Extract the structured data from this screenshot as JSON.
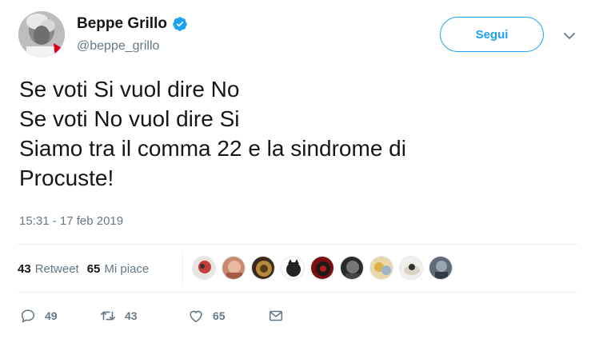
{
  "author": {
    "display_name": "Beppe Grillo",
    "handle": "@beppe_grillo",
    "verified": true
  },
  "follow_label": "Segui",
  "tweet_lines": [
    "Se voti Si vuol dire No",
    "Se voti No vuol dire Si",
    "Siamo tra il comma 22 e la sindrome di",
    "Procuste!"
  ],
  "timestamp": "15:31 - 17 feb 2019",
  "stats": {
    "retweets_count": "43",
    "retweets_label": "Retweet",
    "likes_count": "65",
    "likes_label": "Mi piace"
  },
  "actions": {
    "replies": "49",
    "retweets": "43",
    "likes": "65"
  },
  "colors": {
    "accent": "#1da1f2",
    "muted": "#657786",
    "text": "#14171a",
    "divider": "#e6ecf0"
  }
}
